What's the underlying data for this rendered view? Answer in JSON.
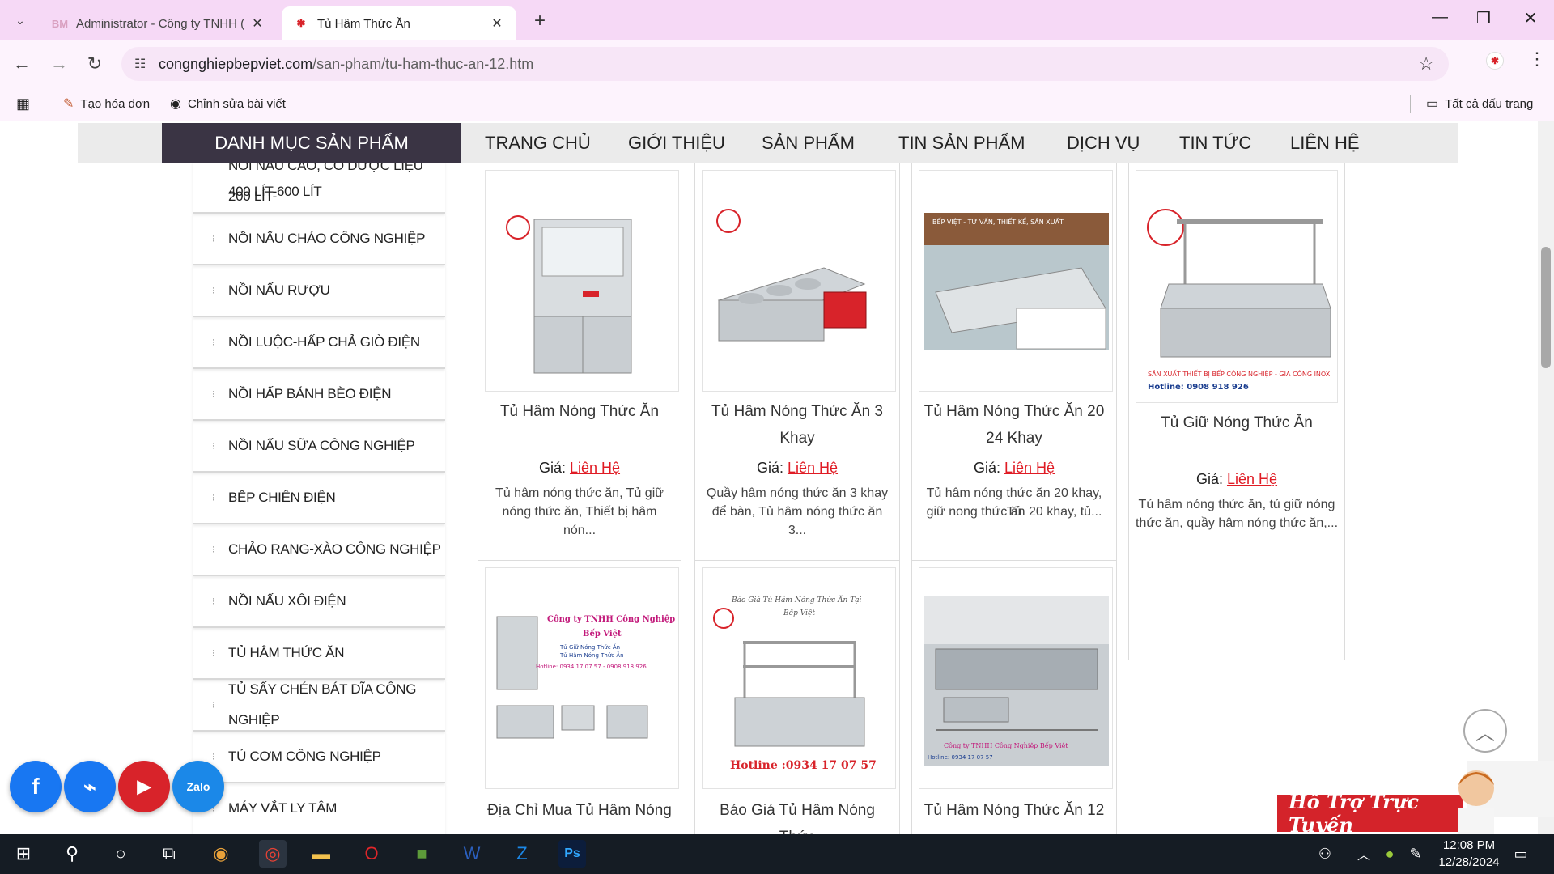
{
  "browser": {
    "tabs": [
      {
        "title": "Administrator - Công ty TNHH (",
        "favicon": "BM"
      },
      {
        "title": "Tủ Hâm Thức Ăn",
        "favicon": "BV"
      }
    ],
    "url_host": "congnghiepbepviet.com",
    "url_path": "/san-pham/tu-ham-thuc-an-12.htm",
    "bookmarks": [
      "Tạo hóa đơn",
      "Chỉnh sửa bài viết"
    ],
    "all_bookmarks": "Tất cả dấu trang"
  },
  "nav": {
    "category_header": "DANH MỤC SẢN PHẨM",
    "items": [
      "TRANG CHỦ",
      "GIỚI THIỆU",
      "SẢN PHẨM",
      "TIN SẢN PHẨM",
      "DỊCH VỤ",
      "TIN TỨC",
      "LIÊN HỆ"
    ]
  },
  "sidebar": {
    "partial_line1": "NỒI NẤU CAO, CÓ DƯỢC LIỆU 200 LÍT-",
    "partial_line2": "400 LÍT-600 LÍT",
    "items": [
      "NỒI NẤU CHÁO CÔNG NGHIỆP",
      "NỒI NẤU RƯỢU",
      "NỒI LUỘC-HẤP CHẢ GIÒ ĐIỆN",
      "NỒI HẤP BÁNH BÈO ĐIỆN",
      "NỒI NẤU SỮA CÔNG NGHIỆP",
      "BẾP CHIÊN ĐIỆN",
      "CHẢO RANG-XÀO CÔNG NGHIỆP",
      "NỒI NẤU XÔI ĐIỆN",
      "TỦ HÂM THỨC ĂN",
      "TỦ SẤY CHÉN BÁT DĨA CÔNG NGHIỆP",
      "TỦ CƠM CÔNG NGHIỆP",
      "MÁY VẮT LY TÂM"
    ]
  },
  "price_label": "Giá:",
  "price_link": "Liên Hệ",
  "products_row1": [
    {
      "name_l1": "Tủ Hâm Nóng Thức Ăn",
      "name_l2": "",
      "desc_l1": "Tủ hâm nóng thức ăn, Tủ giữ",
      "desc_l2": "nóng thức ăn, Thiết bị hâm nón..."
    },
    {
      "name_l1": "Tủ Hâm Nóng Thức Ăn 3",
      "name_l2": "Khay",
      "desc_l1": "Quầy hâm nóng thức ăn 3 khay",
      "desc_l2": "để bàn, Tủ hâm nóng thức ăn 3..."
    },
    {
      "name_l1": "Tủ Hâm Nóng Thức Ăn 20 -",
      "name_l2": "24 Khay",
      "desc_l1": "Tủ hâm nóng thức ăn 20 khay, Tủ",
      "desc_l2": "giữ nong thức ăn 20 khay, tủ..."
    },
    {
      "name_l1": "Tủ Giữ Nóng Thức Ăn",
      "name_l2": "",
      "desc_l1": "Tủ hâm nóng thức ăn, tủ giữ nóng",
      "desc_l2": "thức ăn, quầy hâm nóng thức ăn,..."
    }
  ],
  "products_row2": [
    {
      "name_l1": "Địa Chỉ Mua Tủ Hâm Nóng"
    },
    {
      "name_l1": "Báo Giá Tủ Hâm Nóng Thức"
    },
    {
      "name_l1": "Tủ Hâm Nóng Thức Ăn 12"
    }
  ],
  "image_text": {
    "p3_banner": "BẾP VIỆT - TƯ VẤN, THIẾT KẾ, SẢN XUẤT",
    "p4_line1": "SẢN XUẤT THIẾT BỊ BẾP CÔNG NGHIỆP - GIA CÔNG INOX",
    "p4_line2": "Hotline: 0908 918 926",
    "r2p1_line1": "Công ty TNHH Công Nghiệp",
    "r2p1_line2": "Bếp Việt",
    "r2p1_line3": "Tủ Giữ Nóng Thức Ăn",
    "r2p1_line4": "Tủ Hâm Nóng Thức Ăn",
    "r2p1_line5": "Hotline: 0934 17 07 57 - 0908 918 926",
    "r2p2_line1": "Báo Giá Tủ Hâm Nóng Thức Ăn Tại",
    "r2p2_line2": "Bếp Việt",
    "r2p2_hotline": "Hotline :0934 17 07 57",
    "r2p3_line1": "Công ty TNHH Công Nghiệp Bếp Việt",
    "r2p3_line2": "Hotline: 0934 17 07 57"
  },
  "support_label": "Hỗ Trợ Trực Tuyến",
  "social": [
    "facebook",
    "messenger",
    "youtube",
    "Zalo"
  ],
  "taskbar": {
    "time": "12:08 PM",
    "date": "12/28/2024"
  },
  "colors": {
    "accent_red": "#e01b24",
    "nav_dark": "#3a3444",
    "tab_bg": "#f6d9f6"
  }
}
